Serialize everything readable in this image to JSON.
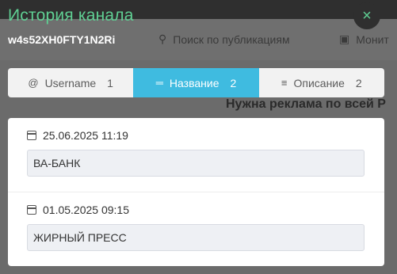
{
  "background": {
    "search_placeholder": "Поиск по публикациям",
    "monitor_label": "Монит",
    "headline": "Нужна реклама по всей Р"
  },
  "modal": {
    "title": "История канала",
    "channel_id": "w4s52XH0FTY1N2Ri",
    "close_icon": "×",
    "tabs": [
      {
        "icon": "at-icon",
        "glyph": "@",
        "label": "Username",
        "count": "1",
        "active": false
      },
      {
        "icon": "title-icon",
        "glyph": "═",
        "label": "Название",
        "count": "2",
        "active": true
      },
      {
        "icon": "description-icon",
        "glyph": "≡",
        "label": "Описание",
        "count": "2",
        "active": false
      }
    ],
    "entries": [
      {
        "date": "25.06.2025 11:19",
        "value": "ВА-БАНК"
      },
      {
        "date": "01.05.2025 09:15",
        "value": "ЖИРНЫЙ ПРЕСС"
      }
    ]
  },
  "colors": {
    "accent_green": "#5fcf93",
    "active_tab": "#3fbbe0"
  }
}
